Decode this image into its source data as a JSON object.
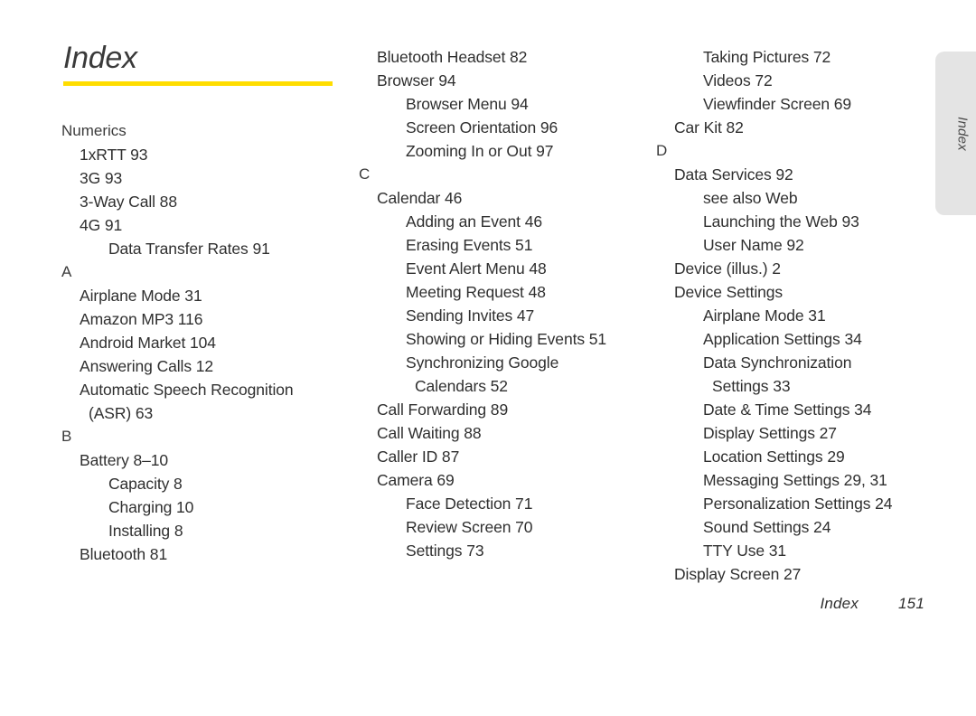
{
  "document": {
    "title": "Index",
    "rule_color": "#ffdd00",
    "side_tab": {
      "label": "Index",
      "background": "#e4e4e4"
    },
    "footer": {
      "label": "Index",
      "page_number": "151"
    }
  },
  "columns": [
    {
      "id": "column-1",
      "entries": [
        {
          "level": "heading",
          "text": "Numerics"
        },
        {
          "level": 1,
          "text": "1xRTT 93"
        },
        {
          "level": 1,
          "text": "3G 93"
        },
        {
          "level": 1,
          "text": "3-Way Call 88"
        },
        {
          "level": 1,
          "text": "4G 91"
        },
        {
          "level": 2,
          "text": "Data Transfer Rates 91"
        },
        {
          "level": "heading",
          "text": "A"
        },
        {
          "level": 1,
          "text": "Airplane Mode 31"
        },
        {
          "level": 1,
          "text": "Amazon MP3 116"
        },
        {
          "level": 1,
          "text": "Android Market 104"
        },
        {
          "level": 1,
          "text": "Answering Calls 12"
        },
        {
          "level": 1,
          "text": "Automatic Speech Recognition"
        },
        {
          "level": "1wrap",
          "text": "(ASR) 63"
        },
        {
          "level": "heading",
          "text": "B"
        },
        {
          "level": 1,
          "text": "Battery 8–10"
        },
        {
          "level": 2,
          "text": "Capacity 8"
        },
        {
          "level": 2,
          "text": "Charging 10"
        },
        {
          "level": 2,
          "text": "Installing 8"
        },
        {
          "level": 1,
          "text": "Bluetooth 81"
        }
      ]
    },
    {
      "id": "column-2",
      "entries": [
        {
          "level": 1,
          "text": "Bluetooth Headset 82"
        },
        {
          "level": 1,
          "text": "Browser 94"
        },
        {
          "level": 2,
          "text": "Browser Menu 94"
        },
        {
          "level": 2,
          "text": "Screen Orientation 96"
        },
        {
          "level": 2,
          "text": "Zooming In or Out 97"
        },
        {
          "level": "heading",
          "text": "C"
        },
        {
          "level": 1,
          "text": "Calendar 46"
        },
        {
          "level": 2,
          "text": "Adding an Event 46"
        },
        {
          "level": 2,
          "text": "Erasing Events 51"
        },
        {
          "level": 2,
          "text": "Event Alert Menu 48"
        },
        {
          "level": 2,
          "text": "Meeting Request 48"
        },
        {
          "level": 2,
          "text": "Sending Invites 47"
        },
        {
          "level": 2,
          "text": "Showing or Hiding Events 51"
        },
        {
          "level": 2,
          "text": "Synchronizing Google"
        },
        {
          "level": "2wrap",
          "text": "Calendars 52"
        },
        {
          "level": 1,
          "text": "Call Forwarding 89"
        },
        {
          "level": 1,
          "text": "Call Waiting 88"
        },
        {
          "level": 1,
          "text": "Caller ID 87"
        },
        {
          "level": 1,
          "text": "Camera 69"
        },
        {
          "level": 2,
          "text": "Face Detection 71"
        },
        {
          "level": 2,
          "text": "Review Screen 70"
        },
        {
          "level": 2,
          "text": "Settings 73"
        }
      ]
    },
    {
      "id": "column-3",
      "entries": [
        {
          "level": 2,
          "text": "Taking Pictures 72"
        },
        {
          "level": 2,
          "text": "Videos 72"
        },
        {
          "level": 2,
          "text": "Viewfinder Screen 69"
        },
        {
          "level": 1,
          "text": "Car Kit 82"
        },
        {
          "level": "heading",
          "text": "D"
        },
        {
          "level": 1,
          "text": "Data Services 92"
        },
        {
          "level": 2,
          "text": "see also Web"
        },
        {
          "level": 2,
          "text": "Launching the Web 93"
        },
        {
          "level": 2,
          "text": "User Name 92"
        },
        {
          "level": 1,
          "text": "Device (illus.) 2"
        },
        {
          "level": 1,
          "text": "Device Settings"
        },
        {
          "level": 2,
          "text": "Airplane Mode 31"
        },
        {
          "level": 2,
          "text": "Application Settings 34"
        },
        {
          "level": 2,
          "text": "Data Synchronization"
        },
        {
          "level": "2wrap",
          "text": "Settings 33"
        },
        {
          "level": 2,
          "text": "Date & Time Settings 34"
        },
        {
          "level": 2,
          "text": "Display Settings 27"
        },
        {
          "level": 2,
          "text": "Location Settings 29"
        },
        {
          "level": 2,
          "text": "Messaging Settings 29, 31"
        },
        {
          "level": 2,
          "text": "Personalization Settings 24"
        },
        {
          "level": 2,
          "text": "Sound Settings 24"
        },
        {
          "level": 2,
          "text": "TTY Use 31"
        },
        {
          "level": 1,
          "text": "Display Screen 27"
        }
      ]
    }
  ]
}
